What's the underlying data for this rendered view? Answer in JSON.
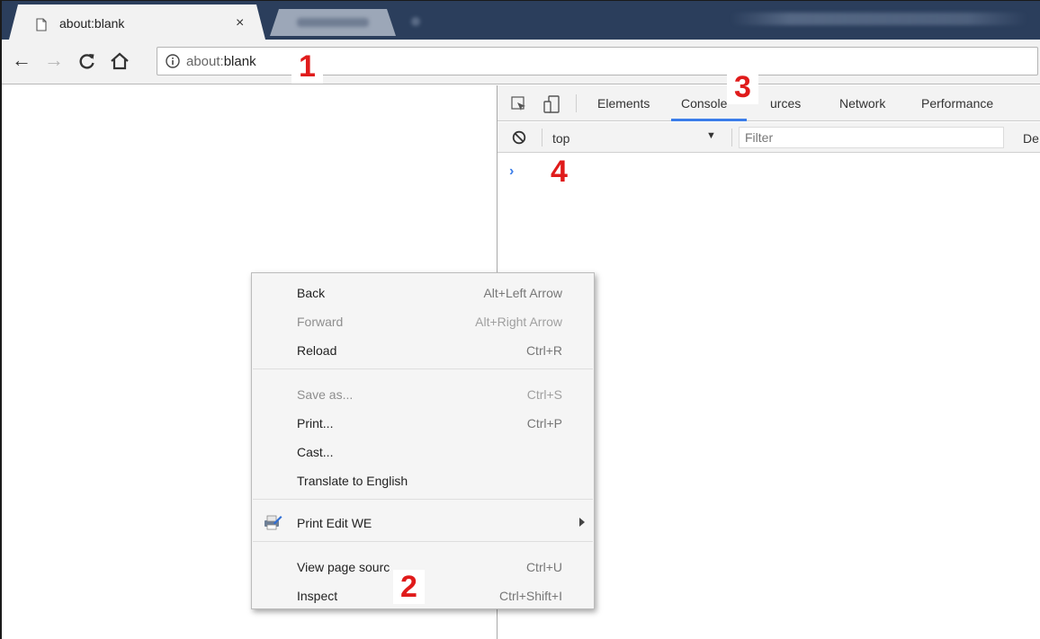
{
  "browser": {
    "active_tab": {
      "title": "about:blank",
      "close_glyph": "×",
      "icon": "page-icon"
    },
    "toolbar": {
      "back_icon": "←",
      "forward_icon": "→",
      "reload_icon": "C",
      "home_icon": "⌂",
      "info_icon": "info-icon",
      "url_scheme": "about:",
      "url_rest": "blank"
    }
  },
  "devtools": {
    "tabs": [
      "Elements",
      "Console",
      "urces",
      "Network",
      "Performance"
    ],
    "active_tab": "Console",
    "console_bar": {
      "context": "top",
      "context_caret": "▼",
      "filter_placeholder": "Filter",
      "levels": "De"
    },
    "prompt": "›",
    "colors": {
      "accent": "#3b7de9"
    }
  },
  "context_menu": {
    "back": {
      "label": "Back",
      "shortcut": "Alt+Left Arrow"
    },
    "forward": {
      "label": "Forward",
      "shortcut": "Alt+Right Arrow"
    },
    "reload": {
      "label": "Reload",
      "shortcut": "Ctrl+R"
    },
    "save_as": {
      "label": "Save as...",
      "shortcut": "Ctrl+S"
    },
    "print": {
      "label": "Print...",
      "shortcut": "Ctrl+P"
    },
    "cast": {
      "label": "Cast..."
    },
    "translate": {
      "label": "Translate to English"
    },
    "print_edit": {
      "label": "Print Edit WE",
      "icon": "printer-pen-icon"
    },
    "view_source": {
      "label": "View page sourc",
      "shortcut": "Ctrl+U"
    },
    "inspect": {
      "label": "Inspect",
      "shortcut": "Ctrl+Shift+I"
    }
  },
  "annotations": {
    "one": "1",
    "two": "2",
    "three": "3",
    "four": "4",
    "color": "#e01b1b"
  }
}
